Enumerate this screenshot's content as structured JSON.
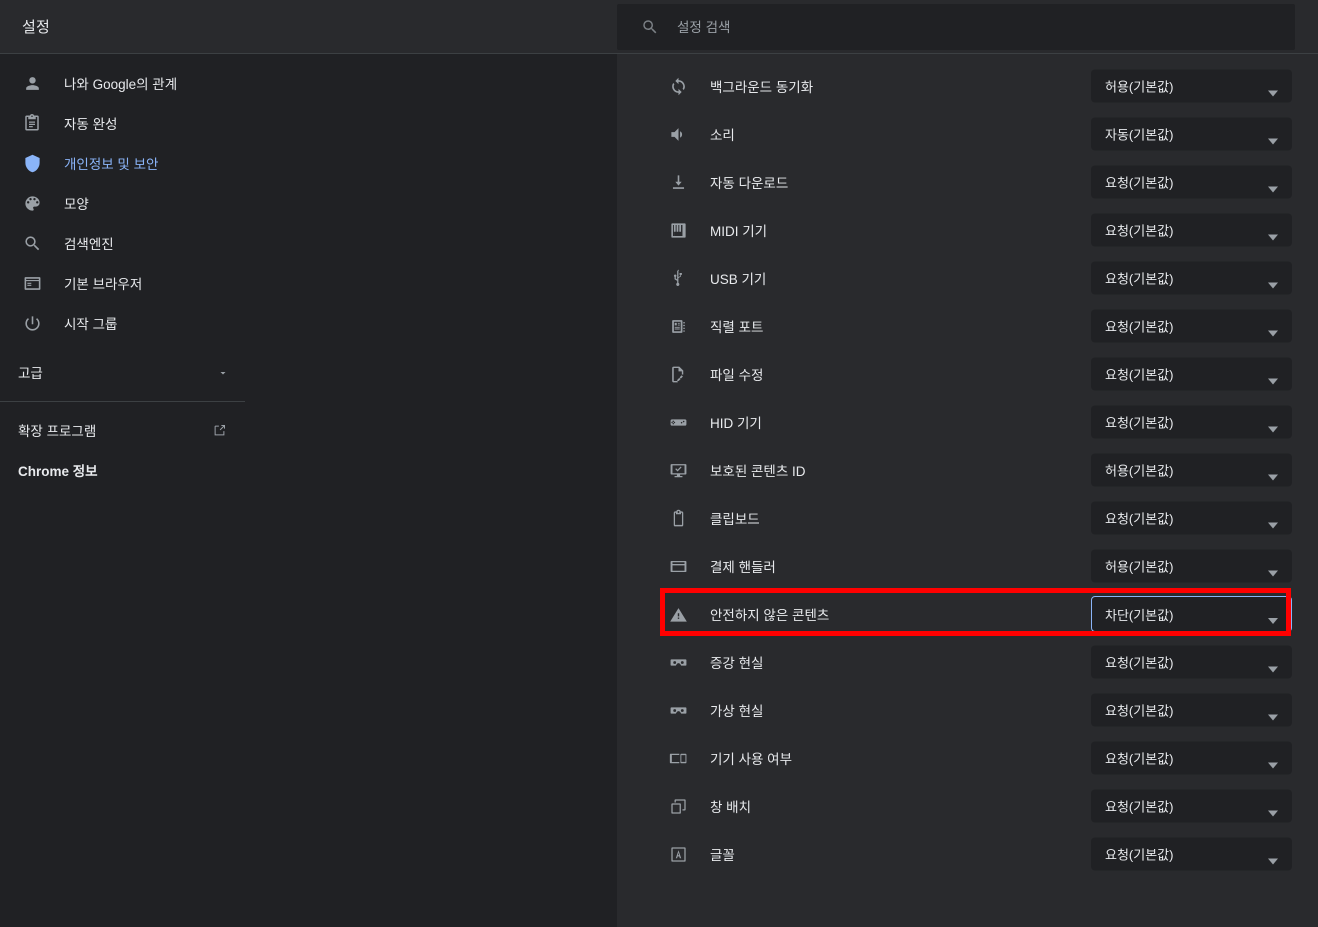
{
  "header": {
    "title": "설정",
    "search": {
      "placeholder": "설정 검색",
      "value": "",
      "icon": "search-icon"
    }
  },
  "sidebar": {
    "items": [
      {
        "label": "나와 Google의 관계",
        "icon": "person-icon",
        "selected": false
      },
      {
        "label": "자동 완성",
        "icon": "clipboard-list-icon",
        "selected": false
      },
      {
        "label": "개인정보 및 보안",
        "icon": "shield-icon",
        "selected": true
      },
      {
        "label": "모양",
        "icon": "palette-icon",
        "selected": false
      },
      {
        "label": "검색엔진",
        "icon": "search-icon",
        "selected": false
      },
      {
        "label": "기본 브라우저",
        "icon": "browser-window-icon",
        "selected": false
      },
      {
        "label": "시작 그룹",
        "icon": "power-icon",
        "selected": false
      }
    ],
    "advanced": {
      "label": "고급",
      "icon": "chevron-down-icon"
    },
    "footer": [
      {
        "label": "확장 프로그램",
        "icon": "external-link-icon",
        "bold": false
      },
      {
        "label": "Chrome 정보",
        "icon": "",
        "bold": true
      }
    ]
  },
  "content": {
    "accent_focus_color": "#8ab4f8",
    "highlight_color": "#ff0000",
    "rows": [
      {
        "label": "백그라운드 동기화",
        "icon": "sync-icon",
        "value": "허용(기본값)",
        "focused": false
      },
      {
        "label": "소리",
        "icon": "volume-icon",
        "value": "자동(기본값)",
        "focused": false
      },
      {
        "label": "자동 다운로드",
        "icon": "download-icon",
        "value": "요청(기본값)",
        "focused": false
      },
      {
        "label": "MIDI 기기",
        "icon": "piano-icon",
        "value": "요청(기본값)",
        "focused": false
      },
      {
        "label": "USB 기기",
        "icon": "usb-icon",
        "value": "요청(기본값)",
        "focused": false
      },
      {
        "label": "직렬 포트",
        "icon": "serial-port-icon",
        "value": "요청(기본값)",
        "focused": false
      },
      {
        "label": "파일 수정",
        "icon": "file-edit-icon",
        "value": "요청(기본값)",
        "focused": false
      },
      {
        "label": "HID 기기",
        "icon": "gamepad-icon",
        "value": "요청(기본값)",
        "focused": false
      },
      {
        "label": "보호된 콘텐츠 ID",
        "icon": "monitor-check-icon",
        "value": "허용(기본값)",
        "focused": false
      },
      {
        "label": "클립보드",
        "icon": "clipboard-icon",
        "value": "요청(기본값)",
        "focused": false
      },
      {
        "label": "결제 핸들러",
        "icon": "credit-card-icon",
        "value": "허용(기본값)",
        "focused": false
      },
      {
        "label": "안전하지 않은 콘텐츠",
        "icon": "warning-triangle-icon",
        "value": "차단(기본값)",
        "focused": true
      },
      {
        "label": "증강 현실",
        "icon": "ar-goggles-icon",
        "value": "요청(기본값)",
        "focused": false
      },
      {
        "label": "가상 현실",
        "icon": "vr-goggles-icon",
        "value": "요청(기본값)",
        "focused": false
      },
      {
        "label": "기기 사용 여부",
        "icon": "device-usage-icon",
        "value": "요청(기본값)",
        "focused": false
      },
      {
        "label": "창 배치",
        "icon": "window-placement-icon",
        "value": "요청(기본값)",
        "focused": false
      },
      {
        "label": "글꼴",
        "icon": "font-icon",
        "value": "요청(기본값)",
        "focused": false
      }
    ]
  }
}
